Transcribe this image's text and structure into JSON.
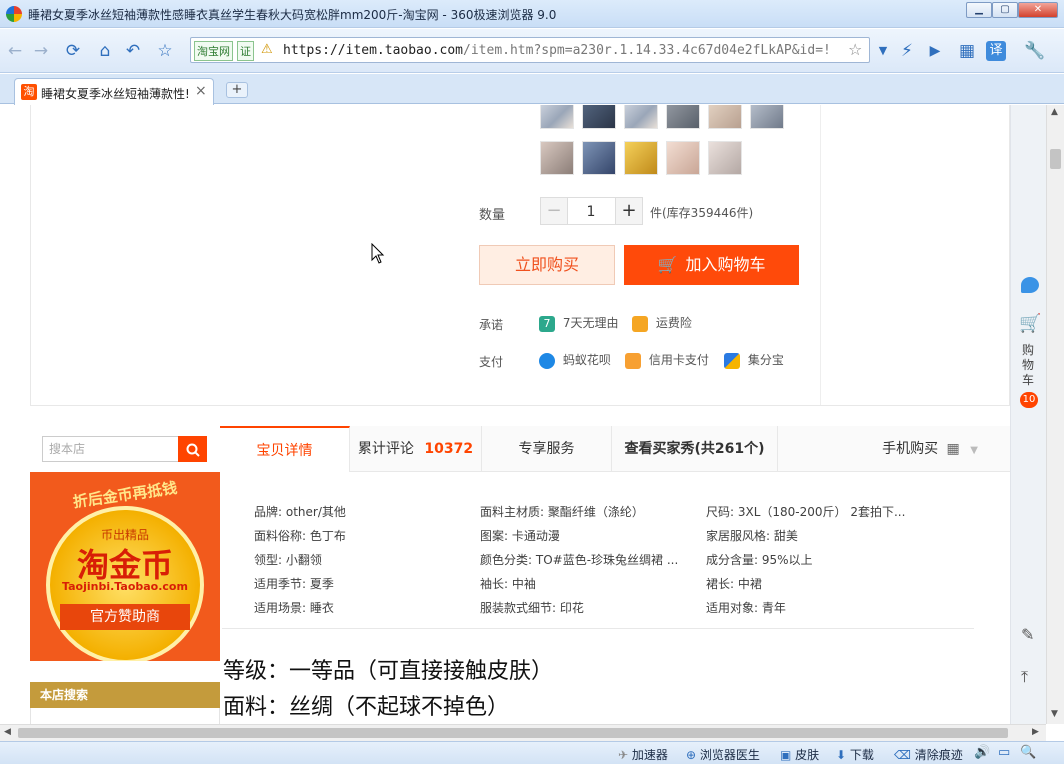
{
  "window": {
    "title": "睡裙女夏季冰丝短袖薄款性感睡衣真丝学生春秋大码宽松胖mm200斤-淘宝网 - 360极速浏览器 9.0"
  },
  "address": {
    "site_badge": "淘宝网",
    "verify_badge": "证",
    "url_main": "https://item.taobao.com",
    "url_rest": "/item.htm?spm=a230r.1.14.33.4c67d04e2fLkAP&id=!"
  },
  "tab": {
    "title": "睡裙女夏季冰丝短袖薄款性!",
    "close": "×",
    "new": "+"
  },
  "product": {
    "qty_label": "数量",
    "qty_minus": "−",
    "qty_value": "1",
    "qty_plus": "+",
    "stock": "件(库存359446件)",
    "buy_now": "立即购买",
    "add_cart": "加入购物车",
    "promise_label": "承诺",
    "promise_1": "7天无理由",
    "promise_2": "运费险",
    "pay_label": "支付",
    "pay_1": "蚂蚁花呗",
    "pay_2": "信用卡支付",
    "pay_3": "集分宝"
  },
  "shop": {
    "search_placeholder": "搜本店",
    "banner_top": "折后金币再抵钱",
    "banner_sub": "币出精品",
    "banner_main": "淘金币",
    "banner_url": "Taojinbi.Taobao.com",
    "banner_bottom": "官方赞助商",
    "search_title": "本店搜索"
  },
  "detail_tabs": {
    "t1": "宝贝详情",
    "t2": "累计评论",
    "t2_count": "10372",
    "t3": "专享服务",
    "t4": "查看买家秀(共261个)",
    "t5": "手机购买"
  },
  "attrs": [
    [
      "品牌: other/其他",
      "面料主材质: 聚酯纤维（涤纶）",
      "尺码: 3XL（180-200斤） 2套拍下..."
    ],
    [
      "面料俗称: 色丁布",
      "图案: 卡通动漫",
      "家居服风格: 甜美"
    ],
    [
      "领型: 小翻领",
      "颜色分类: TO#蓝色-珍珠兔丝绸裙 ...",
      "成分含量: 95%以上"
    ],
    [
      "适用季节: 夏季",
      "袖长: 中袖",
      "裙长: 中裙"
    ],
    [
      "适用场景: 睡衣",
      "服装款式细节: 印花",
      "适用对象: 青年"
    ]
  ],
  "desc": {
    "line1": "等级：一等品（可直接接触皮肤）",
    "line2": "面料：丝绸（不起球不掉色）"
  },
  "sidebar": {
    "cart_label": "购物车",
    "cart_count": "10"
  },
  "status": {
    "s1": "加速器",
    "s2": "浏览器医生",
    "s3": "皮肤",
    "s4": "下载",
    "s5": "清除痕迹"
  }
}
